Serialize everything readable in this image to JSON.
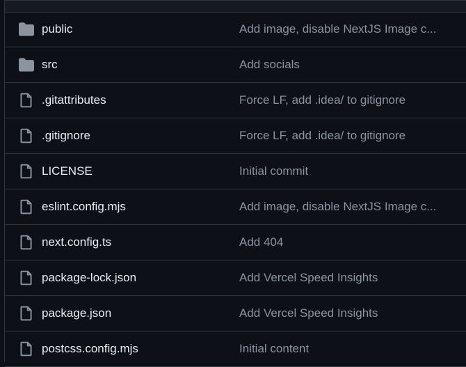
{
  "colors": {
    "background": "#0d1117",
    "border": "#30363d",
    "name_text": "#e6edf3",
    "message_text": "#8b949e",
    "icon": "#8b949e"
  },
  "files": [
    {
      "name": "public",
      "message": "Add image, disable NextJS Image c...",
      "icon": "folder-icon"
    },
    {
      "name": "src",
      "message": "Add socials",
      "icon": "folder-icon"
    },
    {
      "name": ".gitattributes",
      "message": "Force LF, add .idea/ to gitignore",
      "icon": "file-icon"
    },
    {
      "name": ".gitignore",
      "message": "Force LF, add .idea/ to gitignore",
      "icon": "file-icon"
    },
    {
      "name": "LICENSE",
      "message": "Initial commit",
      "icon": "file-icon"
    },
    {
      "name": "eslint.config.mjs",
      "message": "Add image, disable NextJS Image c...",
      "icon": "file-icon"
    },
    {
      "name": "next.config.ts",
      "message": "Add 404",
      "icon": "file-icon"
    },
    {
      "name": "package-lock.json",
      "message": "Add Vercel Speed Insights",
      "icon": "file-icon"
    },
    {
      "name": "package.json",
      "message": "Add Vercel Speed Insights",
      "icon": "file-icon"
    },
    {
      "name": "postcss.config.mjs",
      "message": "Initial content",
      "icon": "file-icon"
    }
  ]
}
